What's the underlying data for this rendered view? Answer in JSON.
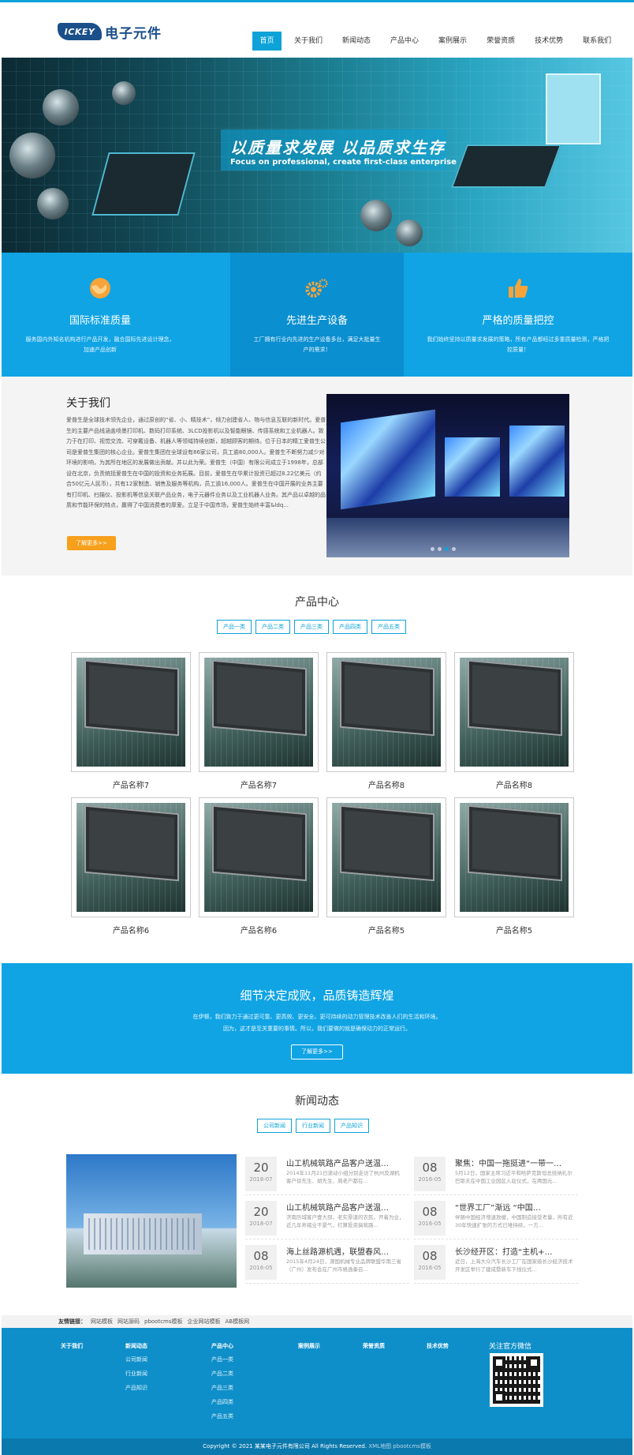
{
  "header": {
    "logo_badge": "ICKEY",
    "logo_text": "电子元件",
    "nav": [
      "首页",
      "关于我们",
      "新闻动态",
      "产品中心",
      "案例展示",
      "荣誉资质",
      "技术优势",
      "联系我们"
    ]
  },
  "banner": {
    "title": "以质量求发展  以品质求生存",
    "subtitle": "Focus on professional, create first-class enterprise"
  },
  "features": [
    {
      "icon": "globe-icon",
      "title": "国际标准质量",
      "desc": "服务国内外知名机构进行产品开发，融合国际先进设计理念，加速产品创新"
    },
    {
      "icon": "gears-icon",
      "title": "先进生产设备",
      "desc": "工厂拥有行业内先进的生产设备多台，满足大批量生产的需求！"
    },
    {
      "icon": "thumbs-up-icon",
      "title": "严格的质量把控",
      "desc": "我们始终坚持以质量求发展的策略，所有产品都经过多重质量检测，严格把控质量！"
    }
  ],
  "about": {
    "title": "关于我们",
    "text": "爱普生是全球技术领先企业，通过原创的“省、小、精技术”，倾力创建省人、物与信息互联的新时代。爱普生的主要产品线涵盖喷墨打印机、数码打印系统、3LCD投影机以及智能眼镜、传感系统和工业机器人。致力于在打印、视觉交流、可穿戴设备、机器人等领域持续创新，超越顾客的期待。位于日本的精工爱普生公司是爱普生集团的核心企业。爱普生集团在全球设有86家公司，员工逾80,000人。爱普生不断努力减少对环境的影响，为其所在地区的发展做出贡献。并以此为荣。爱普生（中国）有限公司成立于1998年，总部设在北京，负责统括爱普生在中国的投资和业务拓展。目前，爱普生在华累计投资已超过8.22亿美元（约合50亿元人民币），共有12家制造、销售及服务等机构，员工逾16,000人。爱普生在中国开展的业务主要有打印机、扫描仪、投影机等信息关联产品业务，电子元器件业务以及工业机器人业务。其产品以卓越的品质和节能环保的特点，赢得了中国消费者的厚爱。立足于中国市场，爱普生始终丰富&ldq...",
    "button": "了解更多>>"
  },
  "products": {
    "title": "产品中心",
    "tabs": [
      "产品一类",
      "产品二类",
      "产品三类",
      "产品四类",
      "产品五类"
    ],
    "items": [
      "产品名称7",
      "产品名称7",
      "产品名称8",
      "产品名称8",
      "产品名称6",
      "产品名称6",
      "产品名称5",
      "产品名称5"
    ]
  },
  "detail": {
    "title": "细节决定成败，品质铸造辉煌",
    "line1": "在伊顿，我们致力于通过更可靠、更高效、更安全、更可持续的动力管理技术改善人们的生活和环境。",
    "line2": "因为，这才是至关重要的事情。所以，我们要做的就是确保动力的正常运行。",
    "button": "了解更多>>"
  },
  "news": {
    "title": "新闻动态",
    "tabs": [
      "公司新闻",
      "行业新闻",
      "产品知识"
    ],
    "items": [
      {
        "day": "20",
        "ym": "2018-07",
        "title": "山工机械筑路产品客户送温…",
        "desc": "2014年11月21日滚动小组分别走访了杭州及湖机客户徐先生、胡先生、周老户都在…"
      },
      {
        "day": "08",
        "ym": "2016-05",
        "title": "聚焦：中国一拖挺进“一带一…",
        "desc": "5月12日，国家主席习近平和哈萨克斯坦总统纳扎尔巴耶夫在中国工业园区入驻仪式，在两国元…"
      },
      {
        "day": "20",
        "ym": "2018-07",
        "title": "山工机械筑路产品客户送温…",
        "desc": "济南历城客户壹大部，老实厚道的农民，开着为业，近几年养猪业不景气，打算投资搞筑路…"
      },
      {
        "day": "08",
        "ym": "2016-05",
        "title": "“世界工厂”渐远 “中国…",
        "desc": "伴随中国经济增速放缓，中国制造接受考量，所有近30年快速扩张的方式已难持续，一方…"
      },
      {
        "day": "08",
        "ym": "2016-05",
        "title": "海上丝路源机遇，联盟春风…",
        "desc": "2015年4月24日，源国机械专业品牌联盟华南三省（广州）发布会在广州市格逸秦召…"
      },
      {
        "day": "08",
        "ym": "2016-05",
        "title": "长沙经开区：打造“主机+…",
        "desc": "近日，上海大众汽车长沙工厂在国家级长沙经济技术开发区举行了建成暨新车下线仪式…"
      }
    ]
  },
  "links": {
    "label": "友情链接：",
    "items": [
      "网站模板",
      "网站源码",
      "pbootcms模板",
      "企业网站模板",
      "AB模板网"
    ]
  },
  "footer": {
    "columns": [
      {
        "head": "关于我们",
        "items": []
      },
      {
        "head": "新闻动态",
        "items": [
          "公司新闻",
          "行业新闻",
          "产品知识"
        ]
      },
      {
        "head": "产品中心",
        "items": [
          "产品一类",
          "产品二类",
          "产品三类",
          "产品四类",
          "产品五类"
        ]
      },
      {
        "head": "案例展示",
        "items": []
      },
      {
        "head": "荣誉资质",
        "items": []
      },
      {
        "head": "技术优势",
        "items": []
      }
    ],
    "qr_title": "关注官方微信",
    "copyright": "Copyright © 2021 某某电子元件有限公司 All Rights Reserved.",
    "copyright_extra": "XML地图  pbootcms模板"
  }
}
